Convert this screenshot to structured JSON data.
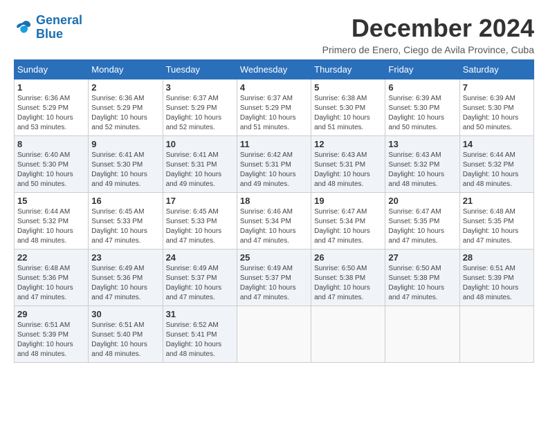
{
  "logo": {
    "line1": "General",
    "line2": "Blue"
  },
  "title": "December 2024",
  "subtitle": "Primero de Enero, Ciego de Avila Province, Cuba",
  "weekdays": [
    "Sunday",
    "Monday",
    "Tuesday",
    "Wednesday",
    "Thursday",
    "Friday",
    "Saturday"
  ],
  "weeks": [
    [
      {
        "day": "1",
        "sunrise": "6:36 AM",
        "sunset": "5:29 PM",
        "daylight": "10 hours and 53 minutes."
      },
      {
        "day": "2",
        "sunrise": "6:36 AM",
        "sunset": "5:29 PM",
        "daylight": "10 hours and 52 minutes."
      },
      {
        "day": "3",
        "sunrise": "6:37 AM",
        "sunset": "5:29 PM",
        "daylight": "10 hours and 52 minutes."
      },
      {
        "day": "4",
        "sunrise": "6:37 AM",
        "sunset": "5:29 PM",
        "daylight": "10 hours and 51 minutes."
      },
      {
        "day": "5",
        "sunrise": "6:38 AM",
        "sunset": "5:30 PM",
        "daylight": "10 hours and 51 minutes."
      },
      {
        "day": "6",
        "sunrise": "6:39 AM",
        "sunset": "5:30 PM",
        "daylight": "10 hours and 50 minutes."
      },
      {
        "day": "7",
        "sunrise": "6:39 AM",
        "sunset": "5:30 PM",
        "daylight": "10 hours and 50 minutes."
      }
    ],
    [
      {
        "day": "8",
        "sunrise": "6:40 AM",
        "sunset": "5:30 PM",
        "daylight": "10 hours and 50 minutes."
      },
      {
        "day": "9",
        "sunrise": "6:41 AM",
        "sunset": "5:30 PM",
        "daylight": "10 hours and 49 minutes."
      },
      {
        "day": "10",
        "sunrise": "6:41 AM",
        "sunset": "5:31 PM",
        "daylight": "10 hours and 49 minutes."
      },
      {
        "day": "11",
        "sunrise": "6:42 AM",
        "sunset": "5:31 PM",
        "daylight": "10 hours and 49 minutes."
      },
      {
        "day": "12",
        "sunrise": "6:43 AM",
        "sunset": "5:31 PM",
        "daylight": "10 hours and 48 minutes."
      },
      {
        "day": "13",
        "sunrise": "6:43 AM",
        "sunset": "5:32 PM",
        "daylight": "10 hours and 48 minutes."
      },
      {
        "day": "14",
        "sunrise": "6:44 AM",
        "sunset": "5:32 PM",
        "daylight": "10 hours and 48 minutes."
      }
    ],
    [
      {
        "day": "15",
        "sunrise": "6:44 AM",
        "sunset": "5:32 PM",
        "daylight": "10 hours and 48 minutes."
      },
      {
        "day": "16",
        "sunrise": "6:45 AM",
        "sunset": "5:33 PM",
        "daylight": "10 hours and 47 minutes."
      },
      {
        "day": "17",
        "sunrise": "6:45 AM",
        "sunset": "5:33 PM",
        "daylight": "10 hours and 47 minutes."
      },
      {
        "day": "18",
        "sunrise": "6:46 AM",
        "sunset": "5:34 PM",
        "daylight": "10 hours and 47 minutes."
      },
      {
        "day": "19",
        "sunrise": "6:47 AM",
        "sunset": "5:34 PM",
        "daylight": "10 hours and 47 minutes."
      },
      {
        "day": "20",
        "sunrise": "6:47 AM",
        "sunset": "5:35 PM",
        "daylight": "10 hours and 47 minutes."
      },
      {
        "day": "21",
        "sunrise": "6:48 AM",
        "sunset": "5:35 PM",
        "daylight": "10 hours and 47 minutes."
      }
    ],
    [
      {
        "day": "22",
        "sunrise": "6:48 AM",
        "sunset": "5:36 PM",
        "daylight": "10 hours and 47 minutes."
      },
      {
        "day": "23",
        "sunrise": "6:49 AM",
        "sunset": "5:36 PM",
        "daylight": "10 hours and 47 minutes."
      },
      {
        "day": "24",
        "sunrise": "6:49 AM",
        "sunset": "5:37 PM",
        "daylight": "10 hours and 47 minutes."
      },
      {
        "day": "25",
        "sunrise": "6:49 AM",
        "sunset": "5:37 PM",
        "daylight": "10 hours and 47 minutes."
      },
      {
        "day": "26",
        "sunrise": "6:50 AM",
        "sunset": "5:38 PM",
        "daylight": "10 hours and 47 minutes."
      },
      {
        "day": "27",
        "sunrise": "6:50 AM",
        "sunset": "5:38 PM",
        "daylight": "10 hours and 47 minutes."
      },
      {
        "day": "28",
        "sunrise": "6:51 AM",
        "sunset": "5:39 PM",
        "daylight": "10 hours and 48 minutes."
      }
    ],
    [
      {
        "day": "29",
        "sunrise": "6:51 AM",
        "sunset": "5:39 PM",
        "daylight": "10 hours and 48 minutes."
      },
      {
        "day": "30",
        "sunrise": "6:51 AM",
        "sunset": "5:40 PM",
        "daylight": "10 hours and 48 minutes."
      },
      {
        "day": "31",
        "sunrise": "6:52 AM",
        "sunset": "5:41 PM",
        "daylight": "10 hours and 48 minutes."
      },
      null,
      null,
      null,
      null
    ]
  ]
}
